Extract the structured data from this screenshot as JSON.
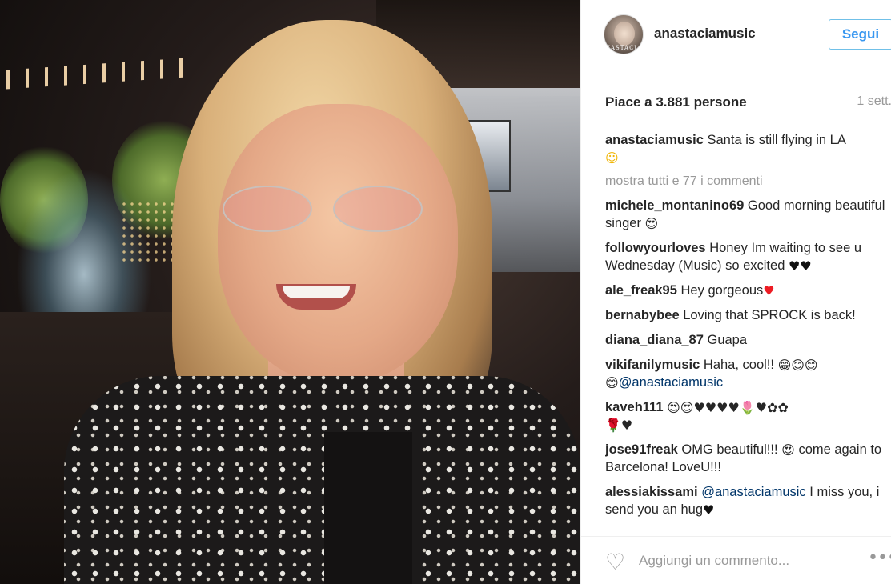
{
  "post": {
    "photo_alt": "selfie",
    "colors": {
      "follow_blue": "#3897f0",
      "follow_border": "#70c0e8",
      "muted": "#999999",
      "text": "#262626"
    }
  },
  "header": {
    "avatar_text": "NASTACIA",
    "username": "anastaciamusic",
    "follow_label": "Segui"
  },
  "meta": {
    "likes": "Piace a 3.881 persone",
    "time": "1 sett."
  },
  "caption": {
    "user": "anastaciamusic",
    "text": "Santa is still flying in LA",
    "emoji": [
      "smile-icon"
    ]
  },
  "show_all": "mostra tutti e 77 i commenti",
  "comments": [
    {
      "user": "michele_montanino69",
      "text": "Good morning beautiful singer",
      "emoji": "😍"
    },
    {
      "user": "followyourloves",
      "text": "Honey Im waiting to see u Wednesday (Music) so excited",
      "emoji": "♥♥"
    },
    {
      "user": "ale_freak95",
      "text": "Hey gorgeous",
      "emoji": "♥"
    },
    {
      "user": "bernabybee",
      "text": "Loving that SPROCK is back!"
    },
    {
      "user": "diana_diana_87",
      "text": "Guapa"
    },
    {
      "user": "vikifanilymusic",
      "text": "Haha, cool!!",
      "emoji": "😁😊😊",
      "emoji2": "😊",
      "mention": "@anastaciamusic"
    },
    {
      "user": "kaveh111",
      "emoji": "😍😍♥♥♥♥🌷♥✿✿",
      "emoji2": "🌹♥"
    },
    {
      "user": "jose91freak",
      "text": "OMG beautiful!!!",
      "emoji": "😍",
      "text2": "come again to Barcelona! LoveU!!!"
    },
    {
      "user": "alessiakissami",
      "mention": "@anastaciamusic",
      "text": "I miss you, i send you an hug",
      "emoji": "♥"
    }
  ],
  "footer": {
    "like_icon": "♡",
    "comment_placeholder": "Aggiungi un commento...",
    "more_icon": "•••"
  }
}
